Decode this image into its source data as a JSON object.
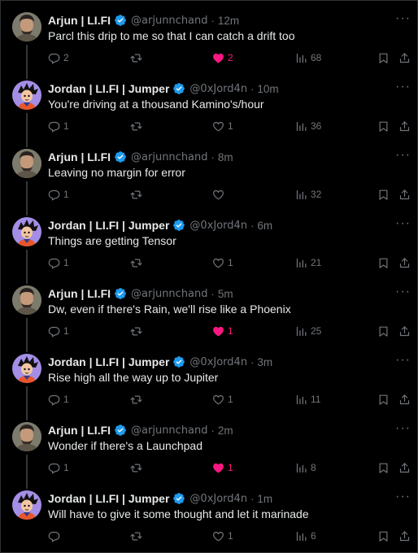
{
  "colors": {
    "background": "#000000",
    "text": "#e7e9ea",
    "muted": "#71767b",
    "like_active": "#f91880",
    "verified": "#1d9bf0",
    "thread_line": "#333639"
  },
  "icons": {
    "reply": "reply-icon",
    "retweet": "retweet-icon",
    "like": "heart-icon",
    "views": "views-icon",
    "bookmark": "bookmark-icon",
    "share": "share-icon",
    "more": "more-icon",
    "verified": "verified-badge-icon"
  },
  "tweets": [
    {
      "name": "Arjun | LI.FI",
      "handle": "@arjunnchand",
      "time": "12m",
      "text": "Parcl this drip to me so that I can catch a drift too",
      "replies": "2",
      "likes": "2",
      "liked": true,
      "views": "68",
      "avatar": "arjun"
    },
    {
      "name": "Jordan | LI.FI | Jumper",
      "handle": "@0xJord4n",
      "time": "10m",
      "text": "You're driving at a thousand Kamino's/hour",
      "replies": "1",
      "likes": "1",
      "liked": false,
      "views": "36",
      "avatar": "jordan"
    },
    {
      "name": "Arjun | LI.FI",
      "handle": "@arjunnchand",
      "time": "8m",
      "text": "Leaving no margin for error",
      "replies": "1",
      "likes": "",
      "liked": false,
      "views": "32",
      "avatar": "arjun"
    },
    {
      "name": "Jordan | LI.FI | Jumper",
      "handle": "@0xJord4n",
      "time": "6m",
      "text": "Things are getting Tensor",
      "replies": "1",
      "likes": "1",
      "liked": false,
      "views": "21",
      "avatar": "jordan"
    },
    {
      "name": "Arjun | LI.FI",
      "handle": "@arjunnchand",
      "time": "5m",
      "text": "Dw, even if there's Rain, we'll rise like a Phoenix",
      "replies": "1",
      "likes": "1",
      "liked": true,
      "views": "25",
      "avatar": "arjun"
    },
    {
      "name": "Jordan | LI.FI | Jumper",
      "handle": "@0xJord4n",
      "time": "3m",
      "text": "Rise high all the way up to Jupiter",
      "replies": "1",
      "likes": "1",
      "liked": false,
      "views": "11",
      "avatar": "jordan"
    },
    {
      "name": "Arjun | LI.FI",
      "handle": "@arjunnchand",
      "time": "2m",
      "text": "Wonder if there's a Launchpad",
      "replies": "1",
      "likes": "1",
      "liked": true,
      "views": "8",
      "avatar": "arjun"
    },
    {
      "name": "Jordan | LI.FI | Jumper",
      "handle": "@0xJord4n",
      "time": "1m",
      "text": "Will have to give it some thought and let it marinade",
      "replies": "",
      "likes": "1",
      "liked": false,
      "views": "6",
      "avatar": "jordan"
    }
  ]
}
